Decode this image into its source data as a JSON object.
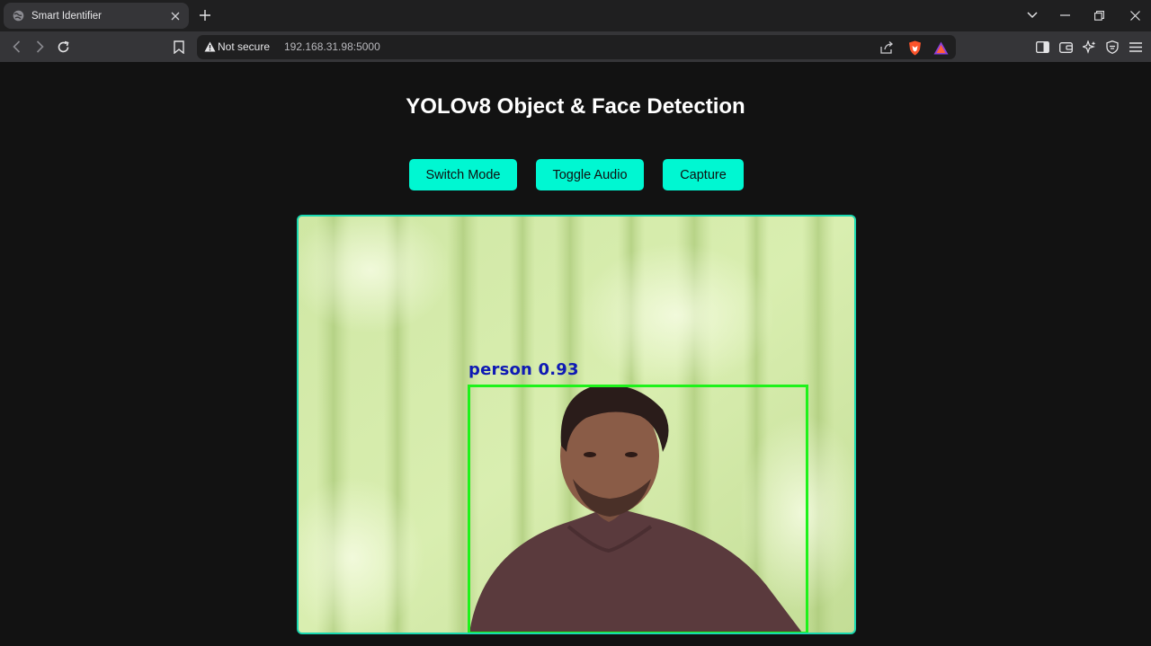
{
  "browser": {
    "tab_title": "Smart Identifier",
    "security_label": "Not secure",
    "url": "192.168.31.98:5000"
  },
  "page": {
    "heading": "YOLOv8 Object & Face Detection",
    "buttons": {
      "switch_mode": "Switch Mode",
      "toggle_audio": "Toggle Audio",
      "capture": "Capture"
    },
    "detection": {
      "label": "person 0.93",
      "box_color": "#1ef21a",
      "label_color": "#0f1ab4"
    }
  },
  "colors": {
    "accent": "#00f7d2",
    "background": "#121212",
    "frame_border": "#19d8b0"
  }
}
